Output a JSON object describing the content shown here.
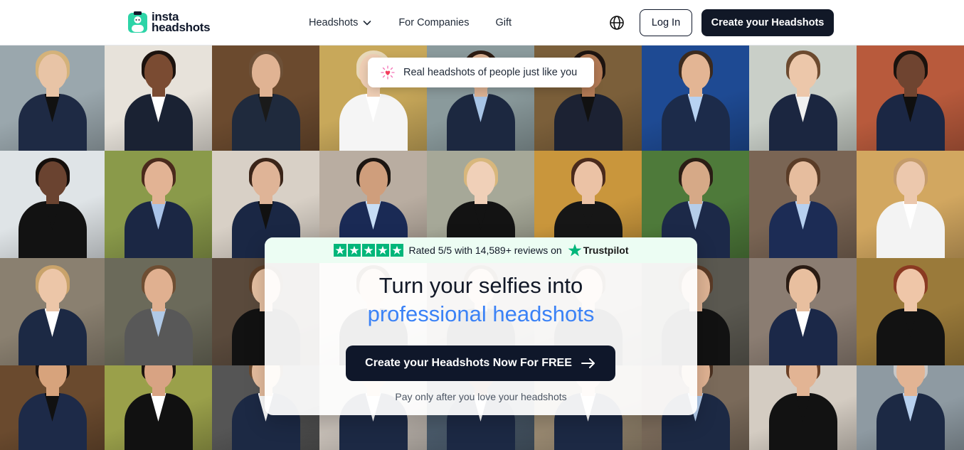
{
  "brand": {
    "line1": "insta",
    "line2": "headshots",
    "accent": "#2dd4a7"
  },
  "nav": {
    "headshots": "Headshots",
    "companies": "For Companies",
    "gift": "Gift"
  },
  "header": {
    "login_label": "Log In",
    "create_label": "Create your Headshots"
  },
  "pill": {
    "text": "Real headshots of people just like you"
  },
  "rating": {
    "text": "Rated 5/5 with 14,589+ reviews on",
    "provider": "Trustpilot",
    "stars": 5,
    "color": "#00b67a"
  },
  "hero": {
    "line1": "Turn your selfies into",
    "line2": "professional headshots",
    "cta_label": "Create your Headshots Now For FREE",
    "subtext": "Pay only after you love your headshots"
  },
  "icons": {
    "chevron": "chevron-down-icon",
    "globe": "globe-icon",
    "arrow": "arrow-right-icon",
    "sparkle": "heart-sparkle-icon"
  },
  "tiles": [
    {
      "bg": "#9aa7ad",
      "skin": "#e8c4a6",
      "hair": "#d4b27a",
      "suit": "#1e2a44",
      "shirt": "#111"
    },
    {
      "bg": "#e7e2da",
      "skin": "#7a4b32",
      "hair": "#1b120e",
      "suit": "#1a2233",
      "shirt": "#fff"
    },
    {
      "bg": "#6b4a2e",
      "skin": "#e0b393",
      "hair": "#6d5037",
      "suit": "#1f2a3d",
      "shirt": "#1a1a1a"
    },
    {
      "bg": "#c8a85a",
      "skin": "#f0cfb5",
      "hair": "#e8d8b9",
      "suit": "#f5f5f5",
      "shirt": "#fff"
    },
    {
      "bg": "#8a9a9c",
      "skin": "#dcb293",
      "hair": "#2c1b12",
      "suit": "#1c2840",
      "shirt": "#a7c4e6"
    },
    {
      "bg": "#7b5f3a",
      "skin": "#b27a55",
      "hair": "#1d1410",
      "suit": "#1c2233",
      "shirt": "#111"
    },
    {
      "bg": "#1e4a93",
      "skin": "#e3b594",
      "hair": "#3b2a1e",
      "suit": "#1c2b4a",
      "shirt": "#b7d2f2"
    },
    {
      "bg": "#c9cfc8",
      "skin": "#ecc7aa",
      "hair": "#6c4a2f",
      "suit": "#1b2640",
      "shirt": "#f0f0f0"
    },
    {
      "bg": "#b85a3c",
      "skin": "#6f4430",
      "hair": "#1a120d",
      "suit": "#1b2744",
      "shirt": "#0f0f0f"
    },
    {
      "bg": "#dfe4e7",
      "skin": "#6a4330",
      "hair": "#140e0b",
      "suit": "#121212",
      "shirt": "#121212"
    },
    {
      "bg": "#8a9a4a",
      "skin": "#e2b394",
      "hair": "#4a2a1c",
      "suit": "#1b2744",
      "shirt": "#a9c3e8"
    },
    {
      "bg": "#d8d0c6",
      "skin": "#dfb497",
      "hair": "#3a2418",
      "suit": "#1a2744",
      "shirt": "#111"
    },
    {
      "bg": "#b9ada1",
      "skin": "#cf9e7c",
      "hair": "#1c1511",
      "suit": "#1a2a55",
      "shirt": "#c7ddf5"
    },
    {
      "bg": "#a6a898",
      "skin": "#f0d0b8",
      "hair": "#d8b77c",
      "suit": "#131313",
      "shirt": "#131313"
    },
    {
      "bg": "#c9963c",
      "skin": "#ebc2a5",
      "hair": "#4a2a1c",
      "suit": "#161616",
      "shirt": "#161616"
    },
    {
      "bg": "#4e7a3a",
      "skin": "#d6a987",
      "hair": "#2a1d15",
      "suit": "#1c2948",
      "shirt": "#b5cde9"
    },
    {
      "bg": "#7a6554",
      "skin": "#e6bd9e",
      "hair": "#5a3c27",
      "suit": "#1c2c55",
      "shirt": "#b7d0ef"
    },
    {
      "bg": "#d2a760",
      "skin": "#ecc8ad",
      "hair": "#c49b6a",
      "suit": "#f3f3f3",
      "shirt": "#fff"
    },
    {
      "bg": "#8a8070",
      "skin": "#ecc6a8",
      "hair": "#c9a36b",
      "suit": "#1c2944",
      "shirt": "#fff"
    },
    {
      "bg": "#6b6a5a",
      "skin": "#e0b090",
      "hair": "#6e4e33",
      "suit": "#585858",
      "shirt": "#b0c9e6"
    },
    {
      "bg": "#5a4a3c",
      "skin": "#e6c0a2",
      "hair": "#5c3e27",
      "suit": "#121212",
      "shirt": "#121212"
    },
    {
      "bg": "#d8d0c6",
      "skin": "#e6c0a2",
      "hair": "#5c3e27",
      "suit": "#121212",
      "shirt": "#121212"
    },
    {
      "bg": "#8a7c6e",
      "skin": "#e6c0a2",
      "hair": "#5c3e27",
      "suit": "#121212",
      "shirt": "#121212"
    },
    {
      "bg": "#8a7c6e",
      "skin": "#e6c0a2",
      "hair": "#5c3e27",
      "suit": "#121212",
      "shirt": "#121212"
    },
    {
      "bg": "#5a5850",
      "skin": "#e0b596",
      "hair": "#5a3a26",
      "suit": "#121212",
      "shirt": "#121212"
    },
    {
      "bg": "#8b7d72",
      "skin": "#e8bf9f",
      "hair": "#2a1c14",
      "suit": "#1b2848",
      "shirt": "#ffffff"
    },
    {
      "bg": "#9a7a3a",
      "skin": "#efc6a8",
      "hair": "#8a3a22",
      "suit": "#121212",
      "shirt": "#121212"
    },
    {
      "bg": "#6a4a2e",
      "skin": "#d7a37c",
      "hair": "#1d140f",
      "suit": "#1d2a48",
      "shirt": "#111"
    },
    {
      "bg": "#9aa04a",
      "skin": "#d8a383",
      "hair": "#1c1410",
      "suit": "#111",
      "shirt": "#fff"
    },
    {
      "bg": "#555",
      "skin": "#e6bd9e",
      "hair": "#6a4a30",
      "suit": "#1c2944",
      "shirt": "#fff"
    },
    {
      "bg": "#c8c0b8",
      "skin": "#e6bd9e",
      "hair": "#6a4a30",
      "suit": "#1c2944",
      "shirt": "#fff"
    },
    {
      "bg": "#4a5a6a",
      "skin": "#8a5a3e",
      "hair": "#1c1410",
      "suit": "#1c2944",
      "shirt": "#fff"
    },
    {
      "bg": "#9a8a72",
      "skin": "#ecc6a8",
      "hair": "#c9a36b",
      "suit": "#1c2944",
      "shirt": "#fff"
    },
    {
      "bg": "#7a6a5a",
      "skin": "#e2b494",
      "hair": "#4a3020",
      "suit": "#1c2944",
      "shirt": "#b7d0ef"
    },
    {
      "bg": "#d4ccc2",
      "skin": "#e2b494",
      "hair": "#6a4026",
      "suit": "#121212",
      "shirt": "#121212"
    },
    {
      "bg": "#8e9aa2",
      "skin": "#e2b494",
      "hair": "#c8c8c8",
      "suit": "#1c2944",
      "shirt": "#b7d0ef"
    }
  ]
}
